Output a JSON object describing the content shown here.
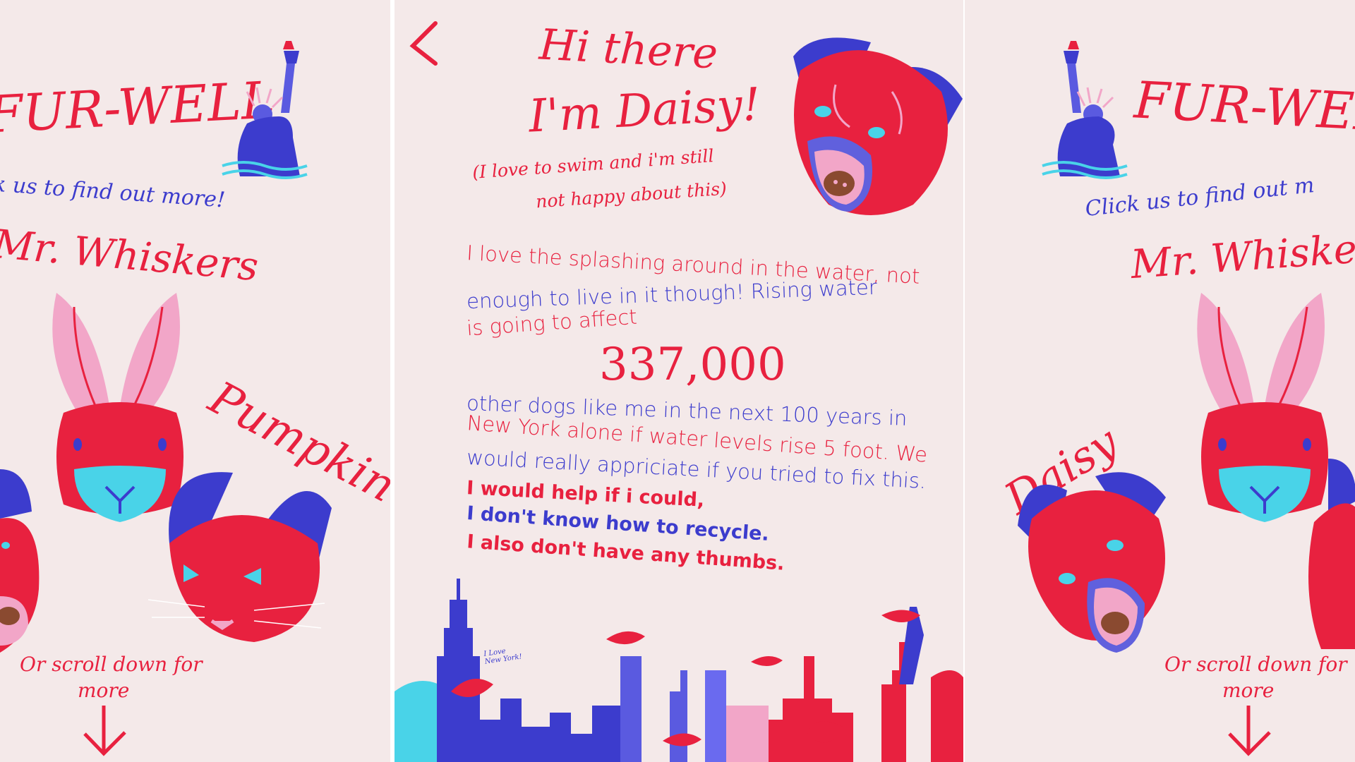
{
  "left_panel": {
    "title": "FUR-WELL",
    "subtitle": "k us to find out more!",
    "rabbit_name": "Mr. Whiskers",
    "cat_name": "Pumpkin",
    "scroll_line1": "Or scroll down for",
    "scroll_line2": "more"
  },
  "center_panel": {
    "heading_line1": "Hi there",
    "heading_line2": "I'm Daisy!",
    "aside_line1": "(I love to swim and i'm still",
    "aside_line2": "not happy about this)",
    "body_lines": [
      "I love the splashing around in the water, not",
      "enough to live in it though! Rising water",
      "is going to affect"
    ],
    "big_number": "337,000",
    "body_lines2": [
      "other dogs like me in the next 100 years in",
      "New York alone if water levels rise 5 foot. We",
      "would really appriciate if you tried to fix this."
    ],
    "bold_lines": [
      "I would help if i could,",
      "I don't know how to recycle.",
      "I also don't have any thumbs."
    ],
    "fish_note": "I Love New York!"
  },
  "right_panel": {
    "title": "FUR-WELL",
    "subtitle": "Click us to find out m",
    "rabbit_name": "Mr. Whiskers",
    "dog_name": "Daisy",
    "scroll_line1": "Or scroll down for",
    "scroll_line2": "more"
  },
  "colors": {
    "background": "#f4e9e9",
    "red": "#e8213f",
    "blue": "#3c3ccd",
    "pink": "#f2a6c8",
    "cyan": "#49d3e8"
  }
}
